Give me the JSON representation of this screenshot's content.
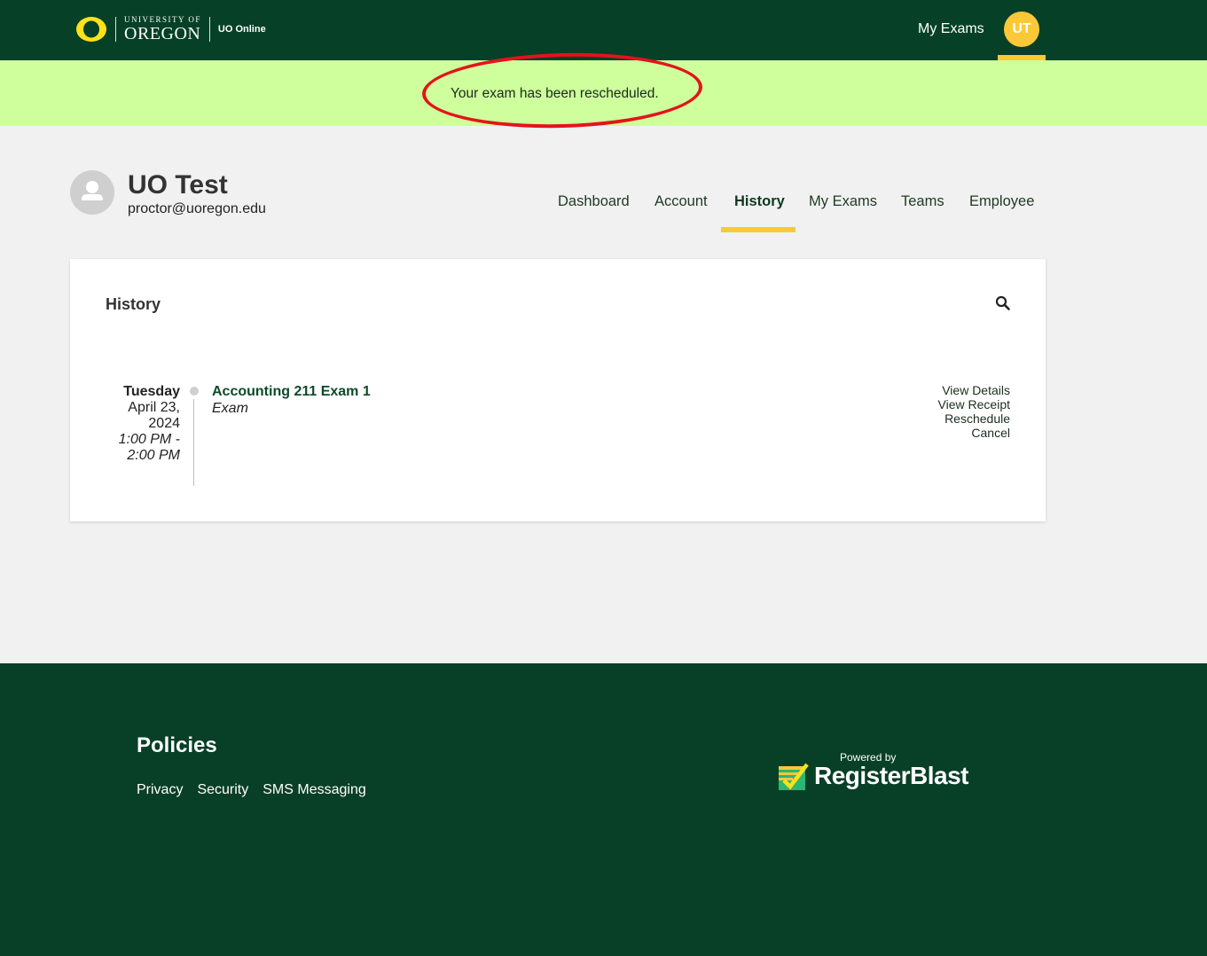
{
  "header": {
    "logo_small": "UNIVERSITY OF",
    "logo_big": "OREGON",
    "logo_online": "UO Online",
    "my_exams": "My Exams",
    "avatar_initials": "UT"
  },
  "banner": {
    "message": "Your exam has been rescheduled."
  },
  "profile": {
    "name": "UO Test",
    "email": "proctor@uoregon.edu"
  },
  "nav": {
    "items": [
      "Dashboard",
      "Account",
      "History",
      "My Exams",
      "Teams",
      "Employee"
    ],
    "active": "History"
  },
  "history": {
    "title": "History",
    "entry": {
      "day": "Tuesday",
      "date_line1": "April 23,",
      "date_line2": "2024",
      "time_line1": "1:00 PM -",
      "time_line2": "2:00 PM",
      "exam_title": "Accounting 211 Exam 1",
      "exam_type": "Exam",
      "actions": [
        "View Details",
        "View Receipt",
        "Reschedule",
        "Cancel"
      ]
    }
  },
  "footer": {
    "policies_title": "Policies",
    "links": [
      "Privacy",
      "Security",
      "SMS Messaging"
    ],
    "powered_by": "Powered by",
    "brand": "RegisterBlast"
  },
  "colors": {
    "header_bg": "#064027",
    "accent_gold": "#fdc837",
    "banner_bg": "#ceff9c",
    "annotation_red": "#e3141a"
  }
}
